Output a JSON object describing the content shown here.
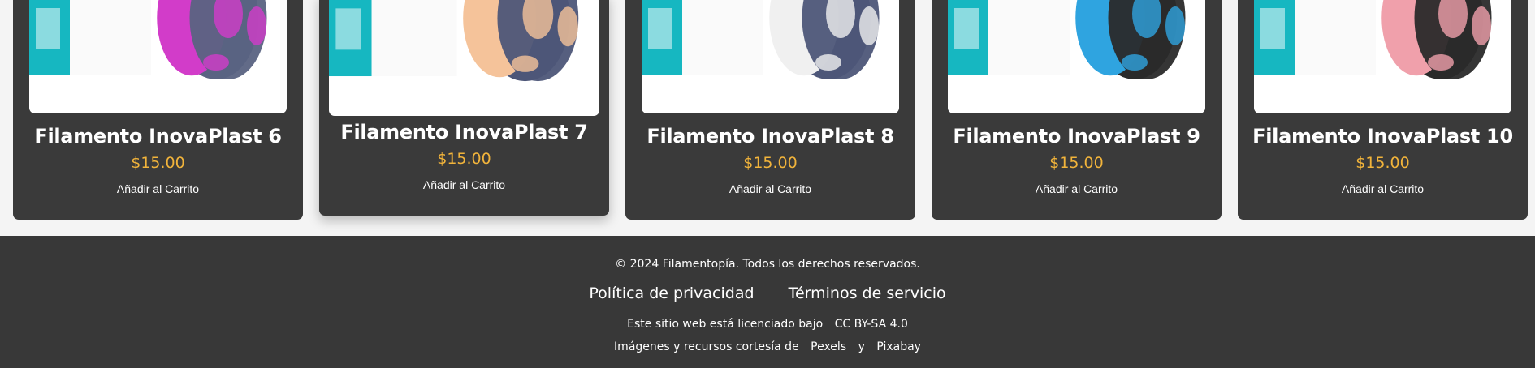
{
  "products": [
    {
      "name": "Filamento InovaPlast 6",
      "price": "$15.00",
      "cart_label": "Añadir al Carrito",
      "filament_color": "#d23cc9",
      "spool_color": "#5a6382"
    },
    {
      "name": "Filamento InovaPlast 7",
      "price": "$15.00",
      "cart_label": "Añadir al Carrito",
      "filament_color": "#f5c39a",
      "spool_color": "#4d5678"
    },
    {
      "name": "Filamento InovaPlast 8",
      "price": "$15.00",
      "cart_label": "Añadir al Carrito",
      "filament_color": "#f0f0f0",
      "spool_color": "#4d5678"
    },
    {
      "name": "Filamento InovaPlast 9",
      "price": "$15.00",
      "cart_label": "Añadir al Carrito",
      "filament_color": "#2fa4e0",
      "spool_color": "#2a2a2a"
    },
    {
      "name": "Filamento InovaPlast 10",
      "price": "$15.00",
      "cart_label": "Añadir al Carrito",
      "filament_color": "#f0a0ab",
      "spool_color": "#2a2a2a"
    }
  ],
  "footer": {
    "copyright": "© 2024 Filamentopía. Todos los derechos reservados.",
    "privacy": "Política de privacidad",
    "terms": "Términos de servicio",
    "license_text": "Este sitio web está licenciado bajo",
    "license_link": "CC BY-SA 4.0",
    "credits_text": "Imágenes y recursos cortesía de",
    "pexels": "Pexels",
    "and": "y",
    "pixabay": "Pixabay"
  },
  "colors": {
    "card_bg": "#3a3a3a",
    "price": "#f2b43b",
    "footer_bg": "#383838",
    "page_bg": "#f4f4f4",
    "box_teal": "#16b7c1"
  }
}
